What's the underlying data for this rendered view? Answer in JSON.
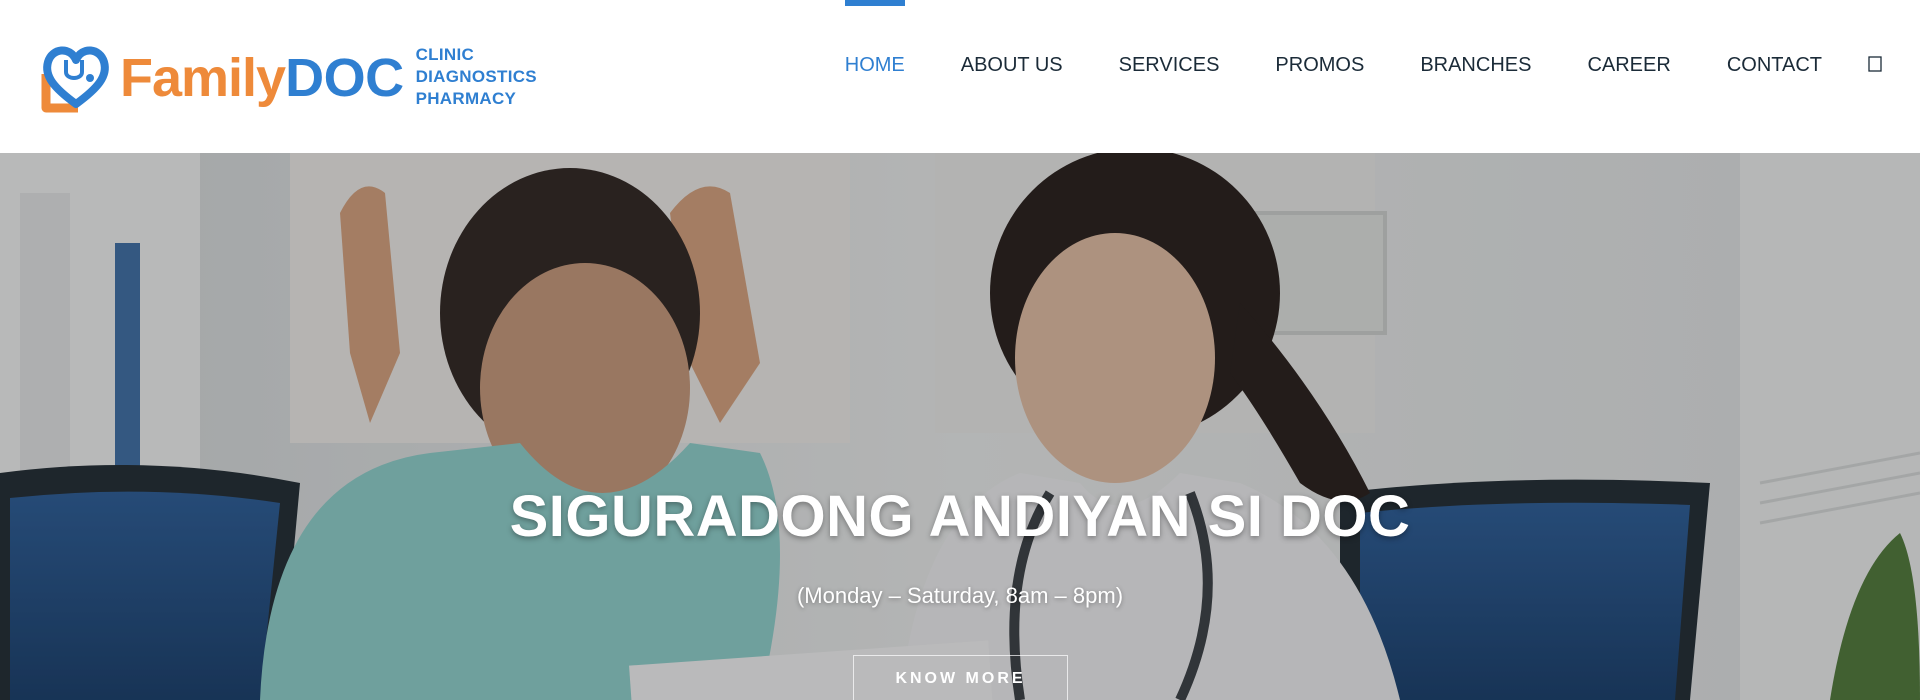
{
  "brand": {
    "family": "Family",
    "doc": "DOC",
    "tagline": [
      "CLINIC",
      "DIAGNOSTICS",
      "PHARMACY"
    ],
    "colors": {
      "orange": "#ee8a3a",
      "blue": "#2f7fd1"
    }
  },
  "nav": {
    "items": [
      {
        "label": "HOME",
        "active": true
      },
      {
        "label": "ABOUT US"
      },
      {
        "label": "SERVICES"
      },
      {
        "label": "PROMOS"
      },
      {
        "label": "BRANCHES"
      },
      {
        "label": "CAREER"
      },
      {
        "label": "CONTACT"
      }
    ],
    "search_icon": "search-icon",
    "active_color": "#2f7fd1"
  },
  "hero": {
    "title": "SIGURADONG ANDIYAN SI DOC",
    "subtitle": "(Monday – Saturday, 8am – 8pm)",
    "button_label": "KNOW MORE"
  }
}
